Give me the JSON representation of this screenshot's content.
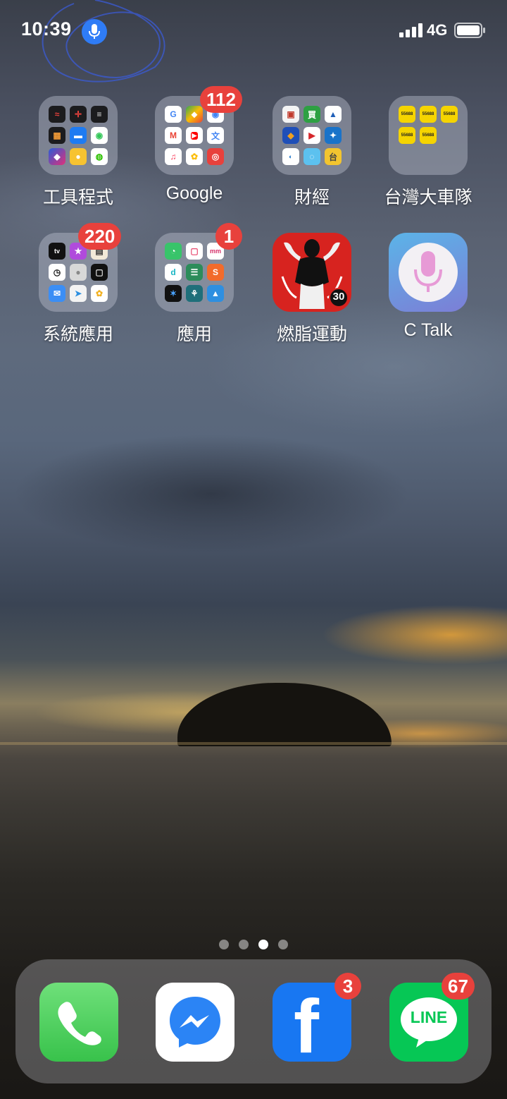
{
  "status_bar": {
    "time": "10:39",
    "network": "4G"
  },
  "home": {
    "row1": [
      {
        "label": "工具程式",
        "type": "folder"
      },
      {
        "label": "Google",
        "type": "folder",
        "badge": "112"
      },
      {
        "label": "財經",
        "type": "folder"
      },
      {
        "label": "台灣大車隊",
        "type": "folder"
      }
    ],
    "row2": [
      {
        "label": "系統應用",
        "type": "folder",
        "badge": "220"
      },
      {
        "label": "應用",
        "type": "folder",
        "badge": "1"
      },
      {
        "label": "燃脂運動",
        "type": "app",
        "icon_text": "30"
      },
      {
        "label": "C Talk",
        "type": "app"
      }
    ],
    "google_minis": [
      "G",
      "M"
    ],
    "taxi_mini_text": "55688",
    "finance_minis": [
      "買",
      "台"
    ],
    "system_minis": [
      "tv"
    ],
    "app_minis": [
      "mm"
    ]
  },
  "page_indicator": {
    "count": 4,
    "active": 3
  },
  "dock": {
    "phone": {
      "label": "Phone"
    },
    "messenger": {
      "label": "Messenger"
    },
    "facebook": {
      "badge": "3",
      "glyph": "f"
    },
    "line": {
      "badge": "67",
      "glyph": "LINE"
    }
  },
  "colors": {
    "badge": "#e8413c",
    "mic_pill": "#2f7cf6",
    "phone_green": "#4cd964",
    "facebook_blue": "#1877f2",
    "line_green": "#06c755"
  }
}
